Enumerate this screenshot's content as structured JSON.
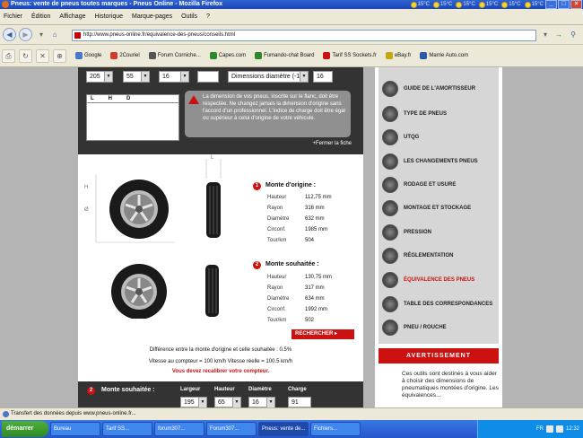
{
  "window": {
    "title": "Pneus: vente de pneus toutes marques - Pneus Online - Mozilla Firefox"
  },
  "weather": [
    {
      "temp": "15°C"
    },
    {
      "temp": "15°C"
    },
    {
      "temp": "15°C"
    },
    {
      "temp": "15°C"
    },
    {
      "temp": "15°C"
    },
    {
      "temp": "15°C"
    }
  ],
  "menu": [
    "Fichier",
    "Édition",
    "Affichage",
    "Historique",
    "Marque-pages",
    "Outils",
    "?"
  ],
  "nav": {
    "url": "http://www.pneus-online.fr/equivalence-des-pneus/conseils.html"
  },
  "bookmarks": [
    {
      "label": "Google",
      "color": "#4a77c8"
    },
    {
      "label": "2Couriel",
      "color": "#d23b2b"
    },
    {
      "label": "Forum Corniche...",
      "color": "#555"
    },
    {
      "label": "Capes.com",
      "color": "#2a8a2a"
    },
    {
      "label": "Fumando-chat Board",
      "color": "#2a8a2a"
    },
    {
      "label": "Tarif SS Sockets.fr",
      "color": "#c11"
    },
    {
      "label": "eBay.fr",
      "color": "#c9a80f"
    },
    {
      "label": "Marrie Auto.com",
      "color": "#2a5aa8"
    }
  ],
  "form": {
    "width": "205",
    "ratio": "55",
    "rim": "16",
    "blank": "",
    "diameter_label": "Dimensions diamètre (-1)",
    "diameter_value": "16",
    "tire_headers": [
      "L",
      "H",
      "D"
    ],
    "warning": "La dimension de vos pneus, inscrite sur le flanc, doit être respectée. Ne changez jamais la dimension d'origine sans l'accord d'un professionnel. L'indice de charge doit être égal ou supérieur à celui d'origine de votre véhicule.",
    "close": "+Fermer la fiche"
  },
  "diagram": {
    "h": "H",
    "d": "Ø",
    "l": "L"
  },
  "origin": {
    "num": "1",
    "title": "Monte d'origine :",
    "rows": [
      {
        "k": "Hauteur",
        "v": "112,75 mm"
      },
      {
        "k": "Rayon",
        "v": "316 mm"
      },
      {
        "k": "Diamètre",
        "v": "632 mm"
      },
      {
        "k": "Circonf.",
        "v": "1985 mm"
      },
      {
        "k": "Tour/km",
        "v": "504"
      }
    ]
  },
  "desired": {
    "num": "2",
    "title": "Monte souhaitée :",
    "rows": [
      {
        "k": "Hauteur",
        "v": "130,75 mm"
      },
      {
        "k": "Rayon",
        "v": "317 mm"
      },
      {
        "k": "Diamètre",
        "v": "634 mm"
      },
      {
        "k": "Circonf.",
        "v": "1992 mm"
      },
      {
        "k": "Tour/km",
        "v": "502"
      }
    ]
  },
  "search_button": "RECHERCHER ▸",
  "difference": "Différence entre la monte d'origine et celle souhaitée : 0.5%",
  "speed": "Vitesse au compteur = 100 km/h    Vitesse réelle = 100.5 km/h",
  "recalibrate": "Vous devez recalibrer votre compteur.",
  "bottom": {
    "num": "2",
    "title": "Monte souhaitée :",
    "cols": [
      "Largeur",
      "Hauteur",
      "Diamètre",
      "Charge"
    ],
    "vals": [
      "195",
      "65",
      "16",
      "91"
    ]
  },
  "sidebar": [
    {
      "label": "GUIDE DE L'AMORTISSEUR"
    },
    {
      "label": "TYPE DE PNEUS"
    },
    {
      "label": "UTQG"
    },
    {
      "label": "LES CHANGEMENTS PNEUS"
    },
    {
      "label": "RODAGE ET USURE"
    },
    {
      "label": "MONTAGE ET STOCKAGE"
    },
    {
      "label": "PRESSION"
    },
    {
      "label": "RÉGLEMENTATION"
    },
    {
      "label": "ÉQUIVALENCE DES PNEUS",
      "active": true
    },
    {
      "label": "TABLE DES CORRESPONDANCES"
    },
    {
      "label": "PNEU / ROUCHE"
    }
  ],
  "avert": {
    "title": "AVERTISSEMENT",
    "body": "Ces outils sont destinés à vous aider à choisir des dimensions de pneumatiques montées d'origine. Les équivalences..."
  },
  "status": "Transfert des données depuis www.pneus-online.fr...",
  "taskbar": {
    "start": "démarrer",
    "tasks": [
      "Bureau",
      "Tarif SS...",
      "forum307...",
      "Forum307...",
      "Pneus: vente de...",
      "Fichiers..."
    ],
    "lang": "FR",
    "clock": "12:32"
  }
}
